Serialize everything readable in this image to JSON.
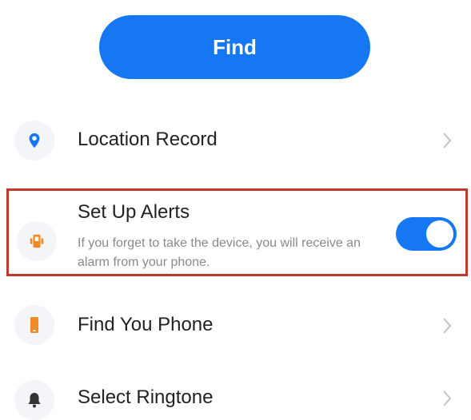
{
  "find_button": {
    "label": "Find"
  },
  "colors": {
    "accent": "#1677f2",
    "highlight_border": "#c0392b",
    "alert_icon": "#f08a24",
    "phone_icon": "#f08a24",
    "bell_icon": "#333333",
    "chevron": "#c4c4c4"
  },
  "menu": {
    "location_record": {
      "label": "Location Record",
      "icon": "location-pin-icon"
    },
    "set_up_alerts": {
      "label": "Set Up Alerts",
      "description": "If you forget to take the device, you will receive an alarm from your phone.",
      "icon": "alarm-device-icon",
      "toggle_on": true
    },
    "find_phone": {
      "label": "Find You Phone",
      "icon": "phone-icon"
    },
    "select_ringtone": {
      "label": "Select Ringtone",
      "icon": "bell-icon"
    }
  }
}
